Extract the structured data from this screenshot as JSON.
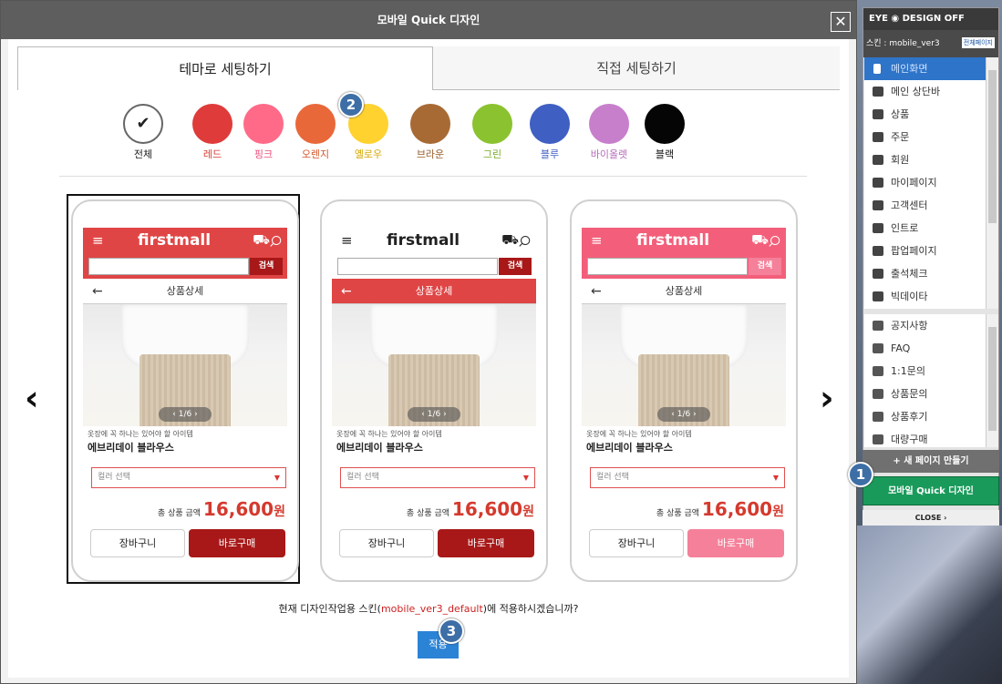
{
  "modal": {
    "title": "모바일 Quick 디자인",
    "close": "✕"
  },
  "tabs": [
    "테마로 세팅하기",
    "직접 세팅하기"
  ],
  "colors": [
    {
      "label": "전체",
      "hex": "#ffffff",
      "label_color": "#222222",
      "check": "✔"
    },
    {
      "label": "레드",
      "hex": "#df3b3b",
      "label_color": "#d43a2e"
    },
    {
      "label": "핑크",
      "hex": "#ff6a88",
      "label_color": "#ea4f7a"
    },
    {
      "label": "오렌지",
      "hex": "#e8683a",
      "label_color": "#d5562a"
    },
    {
      "label": "옐로우",
      "hex": "#ffd230",
      "label_color": "#d7a800"
    },
    {
      "label": "브라운",
      "hex": "#a86a34",
      "label_color": "#965c28"
    },
    {
      "label": "그린",
      "hex": "#8bc22f",
      "label_color": "#78aa24"
    },
    {
      "label": "블루",
      "hex": "#3f5fc2",
      "label_color": "#3f5fc2"
    },
    {
      "label": "바이올렛",
      "hex": "#c77fcb",
      "label_color": "#b36bb8"
    },
    {
      "label": "블랙",
      "hex": "#050505",
      "label_color": "#111111"
    }
  ],
  "badges": [
    "1",
    "2",
    "3"
  ],
  "nav": {
    "prev": "‹",
    "next": "›"
  },
  "previews": [
    {
      "logo": "firstmall",
      "search_btn": "검색",
      "page_title": "상품상세",
      "pager": "‹ 1/6 ›",
      "subtitle": "옷장에 꼭 하나는 있어야 할 아이템",
      "name": "에브리데이 블라우스",
      "option": "컬러 선택",
      "total_label": "총 상품 금액",
      "price": "16,600",
      "won": "원",
      "cart": "장바구니",
      "buy": "바로구매",
      "header_bg": "#e04545",
      "header_fg": "#ffffff",
      "bar_bg": "#ffffff",
      "bar_fg": "#333333",
      "buy_bg": "#a81818",
      "sbtn_bg": "#a81818"
    },
    {
      "logo": "firstmall",
      "search_btn": "검색",
      "page_title": "상품상세",
      "pager": "‹ 1/6 ›",
      "subtitle": "옷장에 꼭 하나는 있어야 할 아이템",
      "name": "에브리데이 블라우스",
      "option": "컬러 선택",
      "total_label": "총 상품 금액",
      "price": "16,600",
      "won": "원",
      "cart": "장바구니",
      "buy": "바로구매",
      "header_bg": "#ffffff",
      "header_fg": "#222222",
      "bar_bg": "#e04545",
      "bar_fg": "#ffffff",
      "buy_bg": "#a81818",
      "sbtn_bg": "#a81818"
    },
    {
      "logo": "firstmall",
      "search_btn": "검색",
      "page_title": "상품상세",
      "pager": "‹ 1/6 ›",
      "subtitle": "옷장에 꼭 하나는 있어야 할 아이템",
      "name": "에브리데이 블라우스",
      "option": "컬러 선택",
      "total_label": "총 상품 금액",
      "price": "16,600",
      "won": "원",
      "cart": "장바구니",
      "buy": "바로구매",
      "header_bg": "#f35f7a",
      "header_fg": "#ffffff",
      "bar_bg": "#ffffff",
      "bar_fg": "#333333",
      "buy_bg": "#f5809a",
      "sbtn_bg": "#f5809a"
    }
  ],
  "confirm": {
    "before": "현재 디자인작업용 스킨(",
    "skin": "mobile_ver3_default",
    "after": ")에 적용하시겠습니까?"
  },
  "apply_label": "적용",
  "panel": {
    "head": "EYE ◉ DESIGN OFF",
    "skin_label": "스킨 : mobile_ver3",
    "all_pages": "전체페이지",
    "menu": [
      "메인화면",
      "메인 상단바",
      "상품",
      "주문",
      "회원",
      "마이페이지",
      "고객센터",
      "인트로",
      "팝업페이지",
      "출석체크",
      "빅데이타"
    ],
    "menu2": [
      "공지사항",
      "FAQ",
      "1:1문의",
      "상품문의",
      "상품후기",
      "대량구매"
    ],
    "new_page": "+ 새 페이지 만들기",
    "quick": "모바일 Quick 디자인",
    "close": "CLOSE ›"
  }
}
